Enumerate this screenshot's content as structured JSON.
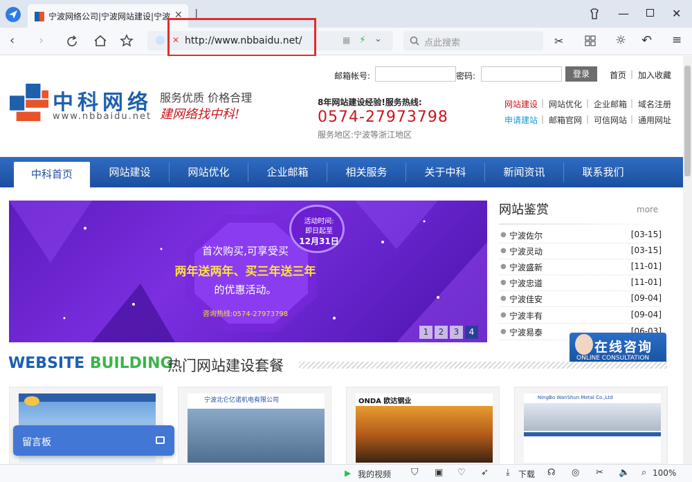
{
  "browser": {
    "tab_title": "宁波网络公司|宁波网站建设|宁波",
    "url": "http://www.nbbaidu.net/",
    "search_placeholder": "点此搜索"
  },
  "login": {
    "email_label": "邮箱帐号:",
    "password_label": "密码:",
    "button": "登录",
    "home_link": "首页",
    "favorite_link": "加入收藏"
  },
  "brand": {
    "name_cn": "中科网络",
    "name_en": "www.nbbaidu.net",
    "slogan1": "服务优质  价格合理",
    "slogan2": "建网络找中科!"
  },
  "hotline": {
    "line1": "8年网站建设经验!服务热线:",
    "phone": "0574-27973798",
    "area": "服务地区:宁波等浙江地区"
  },
  "quick_links": {
    "row1": [
      "网站建设",
      "网站优化",
      "企业邮箱",
      "域名注册"
    ],
    "row2": [
      "申请建站",
      "邮箱官网",
      "可信网站",
      "通用网址"
    ]
  },
  "nav": [
    "中科首页",
    "网站建设",
    "网站优化",
    "企业邮箱",
    "相关服务",
    "关于中科",
    "新闻资讯",
    "联系我们"
  ],
  "banner": {
    "badge_line1": "活动时间:",
    "badge_line2": "即日起至",
    "badge_line3": "12月31日",
    "line1": "首次购买,可享受买",
    "line2": "两年送两年、买三年送三年",
    "line3": "的优惠活动。",
    "line4": "咨询热线:0574-27973798",
    "pages": [
      "1",
      "2",
      "3",
      "4"
    ]
  },
  "showcase": {
    "title": "网站鉴赏",
    "more": "more",
    "items": [
      {
        "name": "宁波佐尔",
        "date": "[03-15]"
      },
      {
        "name": "宁波灵动",
        "date": "[03-15]"
      },
      {
        "name": "宁波盛新",
        "date": "[11-01]"
      },
      {
        "name": "宁波忠道",
        "date": "[11-01]"
      },
      {
        "name": "宁波佳安",
        "date": "[09-04]"
      },
      {
        "name": "宁波丰有",
        "date": "[09-04]"
      },
      {
        "name": "宁波易泰",
        "date": "[06-03]"
      }
    ]
  },
  "consult": {
    "cn": "在线咨询",
    "en": "ONLINE CONSULTATION"
  },
  "section": {
    "en_a": "WEBSITE",
    "en_b": "BUILDING",
    "cn": "热门网站建设套餐"
  },
  "cards": [
    {
      "title": ""
    },
    {
      "title": "宁波北仑亿诺机电有限公司"
    },
    {
      "title": "ONDA 欧达钢业"
    },
    {
      "title": "NingBo WanShun Metal Co.,Ltd"
    }
  ],
  "message_board": "留言板",
  "statusbar": {
    "video": "我的视频",
    "download": "下载",
    "zoom": "100%"
  },
  "colors": {
    "brand_blue": "#1b4f9f",
    "phone_red": "#c8161d",
    "banner_purple": "#6a22cc"
  }
}
